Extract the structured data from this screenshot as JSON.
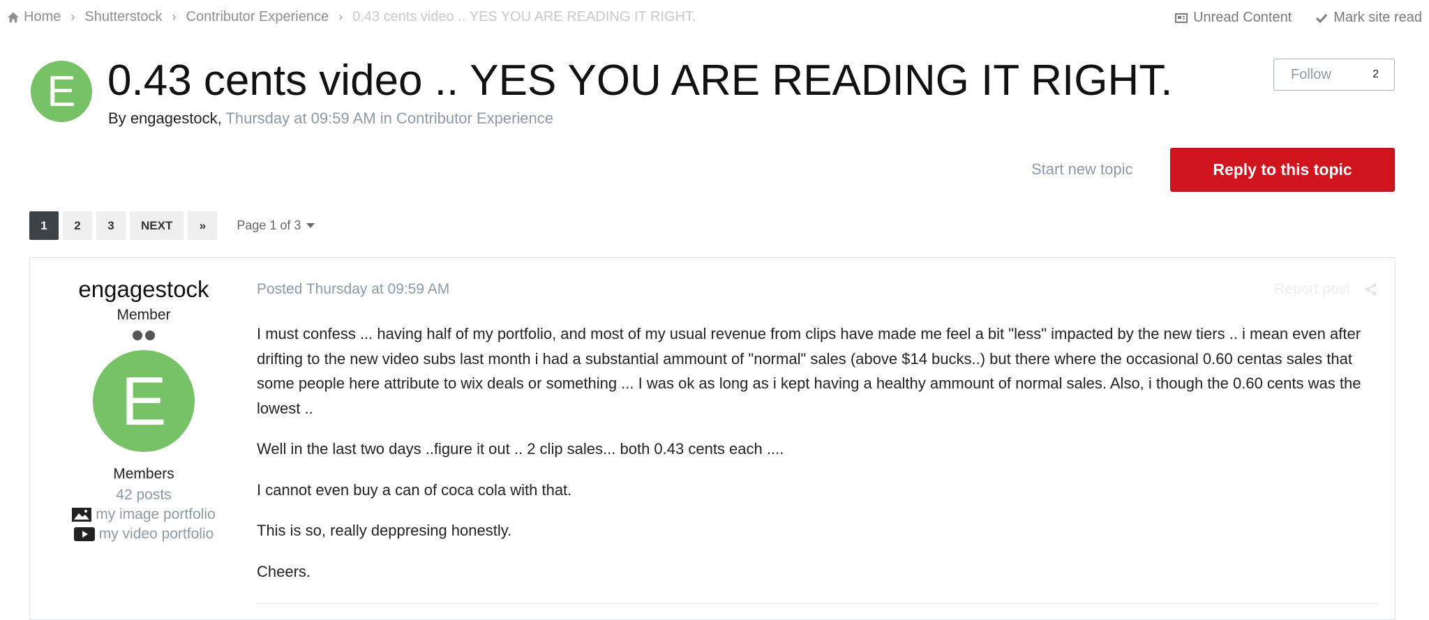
{
  "breadcrumb": {
    "items": [
      "Home",
      "Shutterstock",
      "Contributor Experience"
    ],
    "current": "0.43 cents video .. YES YOU ARE READING IT RIGHT."
  },
  "top_links": {
    "unread": "Unread Content",
    "mark_read": "Mark site read"
  },
  "topic": {
    "avatar_letter": "E",
    "title": "0.43 cents video .. YES YOU ARE READING IT RIGHT.",
    "by_prefix": "By",
    "author": "engagestock,",
    "date_forum": "Thursday at 09:59 AM in Contributor Experience"
  },
  "follow": {
    "label": "Follow",
    "count": "2"
  },
  "actions": {
    "start_new": "Start new topic",
    "reply": "Reply to this topic"
  },
  "pagination": {
    "pages": [
      "1",
      "2",
      "3"
    ],
    "active": "1",
    "next": "NEXT",
    "last_glyph": "»",
    "page_info": "Page 1 of 3"
  },
  "post": {
    "author": {
      "name": "engagestock",
      "role": "Member",
      "avatar_letter": "E",
      "group": "Members",
      "posts": "42 posts",
      "image_portfolio": "my image portfolio",
      "video_portfolio": "my video portfolio"
    },
    "posted": "Posted Thursday at 09:59 AM",
    "report": "Report post",
    "paragraphs": [
      "I must confess ... having half of my portfolio, and most of my usual revenue from clips have made me feel a bit \"less\" impacted by the new tiers .. i mean even after drifting to the new video subs last month i had a substantial ammount of \"normal\" sales (above $14 bucks..) but there where the occasional 0.60 centas sales that some people here attribute to wix deals or something ... I was ok as long as i kept having a healthy ammount of normal sales. Also, i though the 0.60 cents was the lowest ..",
      "Well in the last two days ..figure it out .. 2 clip sales... both 0.43 cents each ....",
      "I cannot even buy a can of coca cola with that.",
      "This is so, really deppresing honestly.",
      "Cheers."
    ]
  },
  "colors": {
    "accent_red": "#d0141e",
    "avatar_green": "#77c167",
    "muted_text": "#8c9aa8"
  }
}
